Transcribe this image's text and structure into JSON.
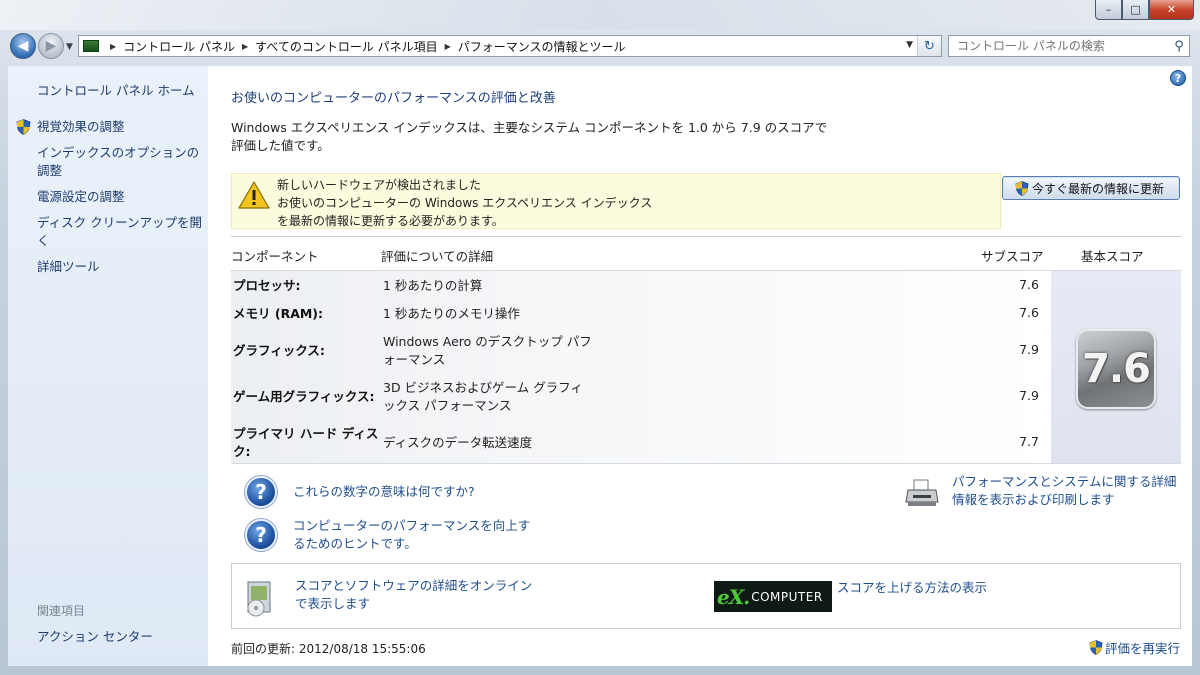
{
  "window": {
    "min_glyph": "–",
    "max_glyph": "□",
    "close_glyph": "✕"
  },
  "nav": {
    "breadcrumbs": [
      "コントロール パネル",
      "すべてのコントロール パネル項目",
      "パフォーマンスの情報とツール"
    ],
    "search_placeholder": "コントロール パネルの検索"
  },
  "sidebar": {
    "home": "コントロール パネル ホーム",
    "items": [
      "視覚効果の調整",
      "インデックスのオプションの調整",
      "電源設定の調整",
      "ディスク クリーンアップを開く",
      "詳細ツール"
    ],
    "related_heading": "関連項目",
    "related_items": [
      "アクション センター"
    ]
  },
  "main": {
    "title": "お使いのコンピューターのパフォーマンスの評価と改善",
    "intro": "Windows エクスペリエンス インデックスは、主要なシステム コンポーネントを 1.0 から 7.9 のスコアで評価した値です。",
    "alert": {
      "heading": "新しいハードウェアが検出されました",
      "body": "お使いのコンピューターの Windows エクスペリエンス インデックスを最新の情報に更新する必要があります。"
    },
    "update_button": "今すぐ最新の情報に更新",
    "table": {
      "headers": {
        "component": "コンポーネント",
        "detail": "評価についての詳細",
        "subscore": "サブスコア",
        "base_score": "基本スコア"
      },
      "rows": [
        {
          "component": "プロセッサ:",
          "detail": "1 秒あたりの計算",
          "subscore": "7.6"
        },
        {
          "component": "メモリ (RAM):",
          "detail": "1 秒あたりのメモリ操作",
          "subscore": "7.6"
        },
        {
          "component": "グラフィックス:",
          "detail": "Windows Aero のデスクトップ パフォーマンス",
          "subscore": "7.9"
        },
        {
          "component": "ゲーム用グラフィックス:",
          "detail": "3D ビジネスおよびゲーム グラフィックス パフォーマンス",
          "subscore": "7.9"
        },
        {
          "component": "プライマリ ハード ディスク:",
          "detail": "ディスクのデータ転送速度",
          "subscore": "7.7"
        }
      ],
      "base_score": "7.6"
    },
    "links": {
      "what_numbers_mean": "これらの数字の意味は何ですか?",
      "tips": "コンピューターのパフォーマンスを向上するためのヒントです。",
      "print_details": "パフォーマンスとシステムに関する詳細情報を表示および印刷します",
      "online_details": "スコアとソフトウェアの詳細をオンラインで表示します",
      "raise_score": "スコアを上げる方法の表示"
    },
    "advert": {
      "ex": "eX.",
      "computer": "COMPUTER"
    },
    "last_update": "前回の更新: 2012/08/18 15:55:06",
    "rerun": "評価を再実行"
  }
}
